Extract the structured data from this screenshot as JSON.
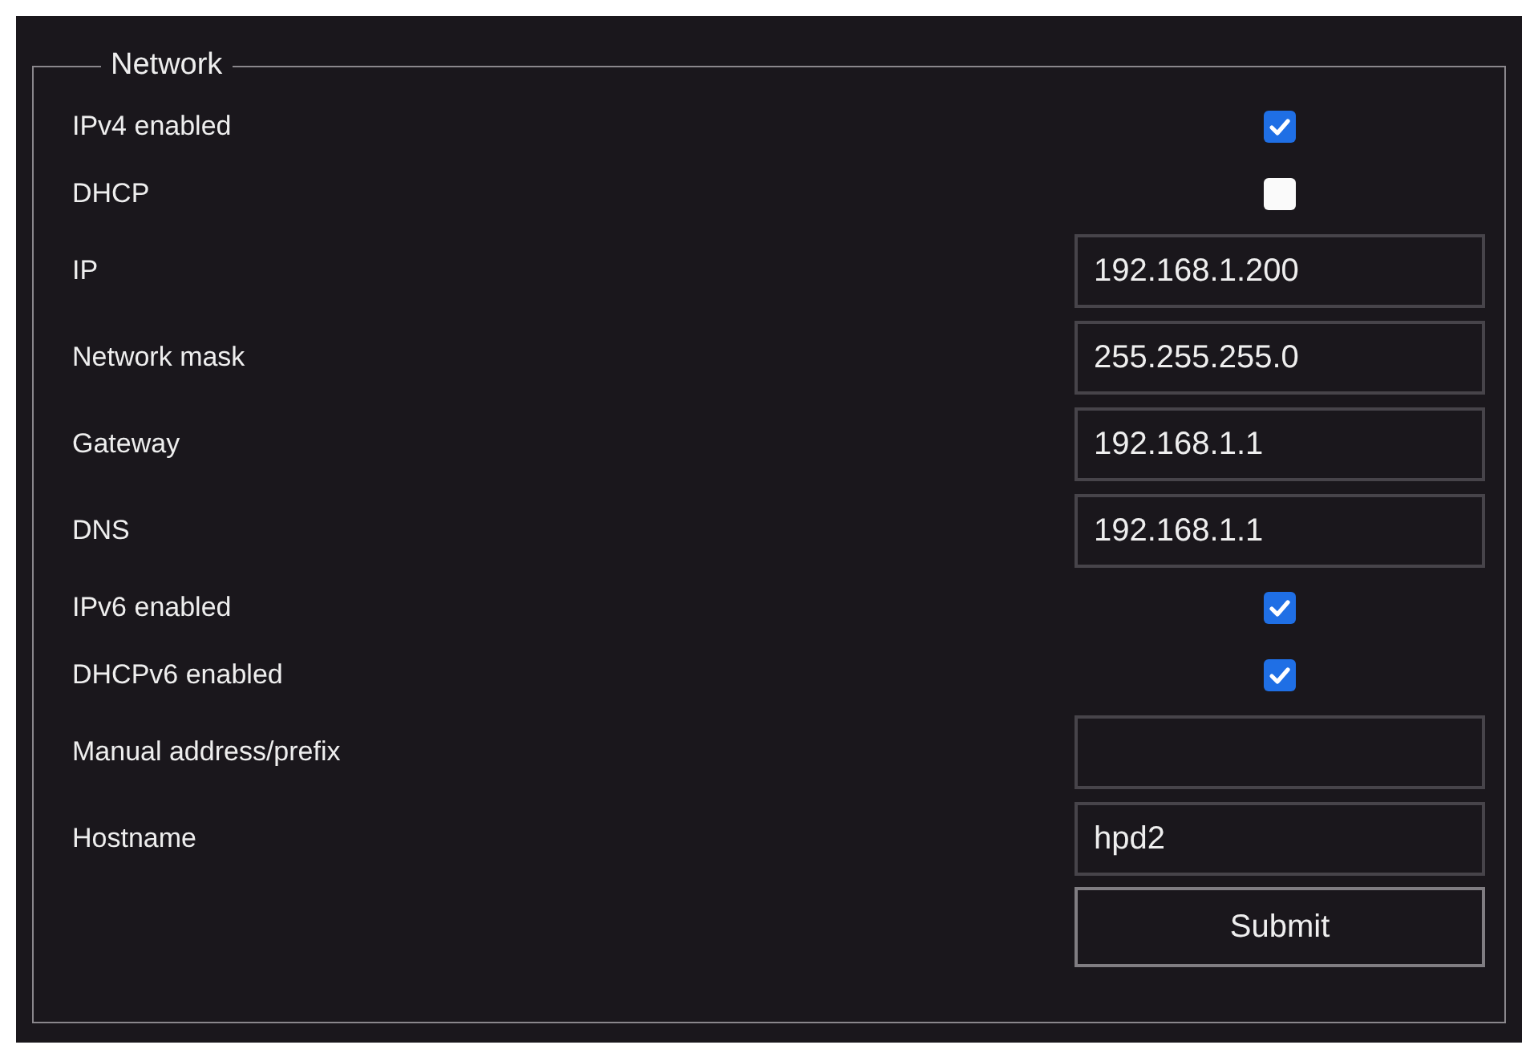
{
  "section": {
    "title": "Network"
  },
  "rows": [
    {
      "kind": "checkbox",
      "label": "IPv4 enabled",
      "checked": true
    },
    {
      "kind": "checkbox",
      "label": "DHCP",
      "checked": false
    },
    {
      "kind": "text",
      "label": "IP",
      "value": "192.168.1.200"
    },
    {
      "kind": "text",
      "label": "Network mask",
      "value": "255.255.255.0"
    },
    {
      "kind": "text",
      "label": "Gateway",
      "value": "192.168.1.1"
    },
    {
      "kind": "text",
      "label": "DNS",
      "value": "192.168.1.1"
    },
    {
      "kind": "checkbox",
      "label": "IPv6 enabled",
      "checked": true
    },
    {
      "kind": "checkbox",
      "label": "DHCPv6 enabled",
      "checked": true
    },
    {
      "kind": "text",
      "label": "Manual address/prefix"
    },
    {
      "kind": "text",
      "label": "Hostname",
      "value": "hpd2"
    },
    {
      "kind": "button",
      "label": "Submit"
    }
  ]
}
